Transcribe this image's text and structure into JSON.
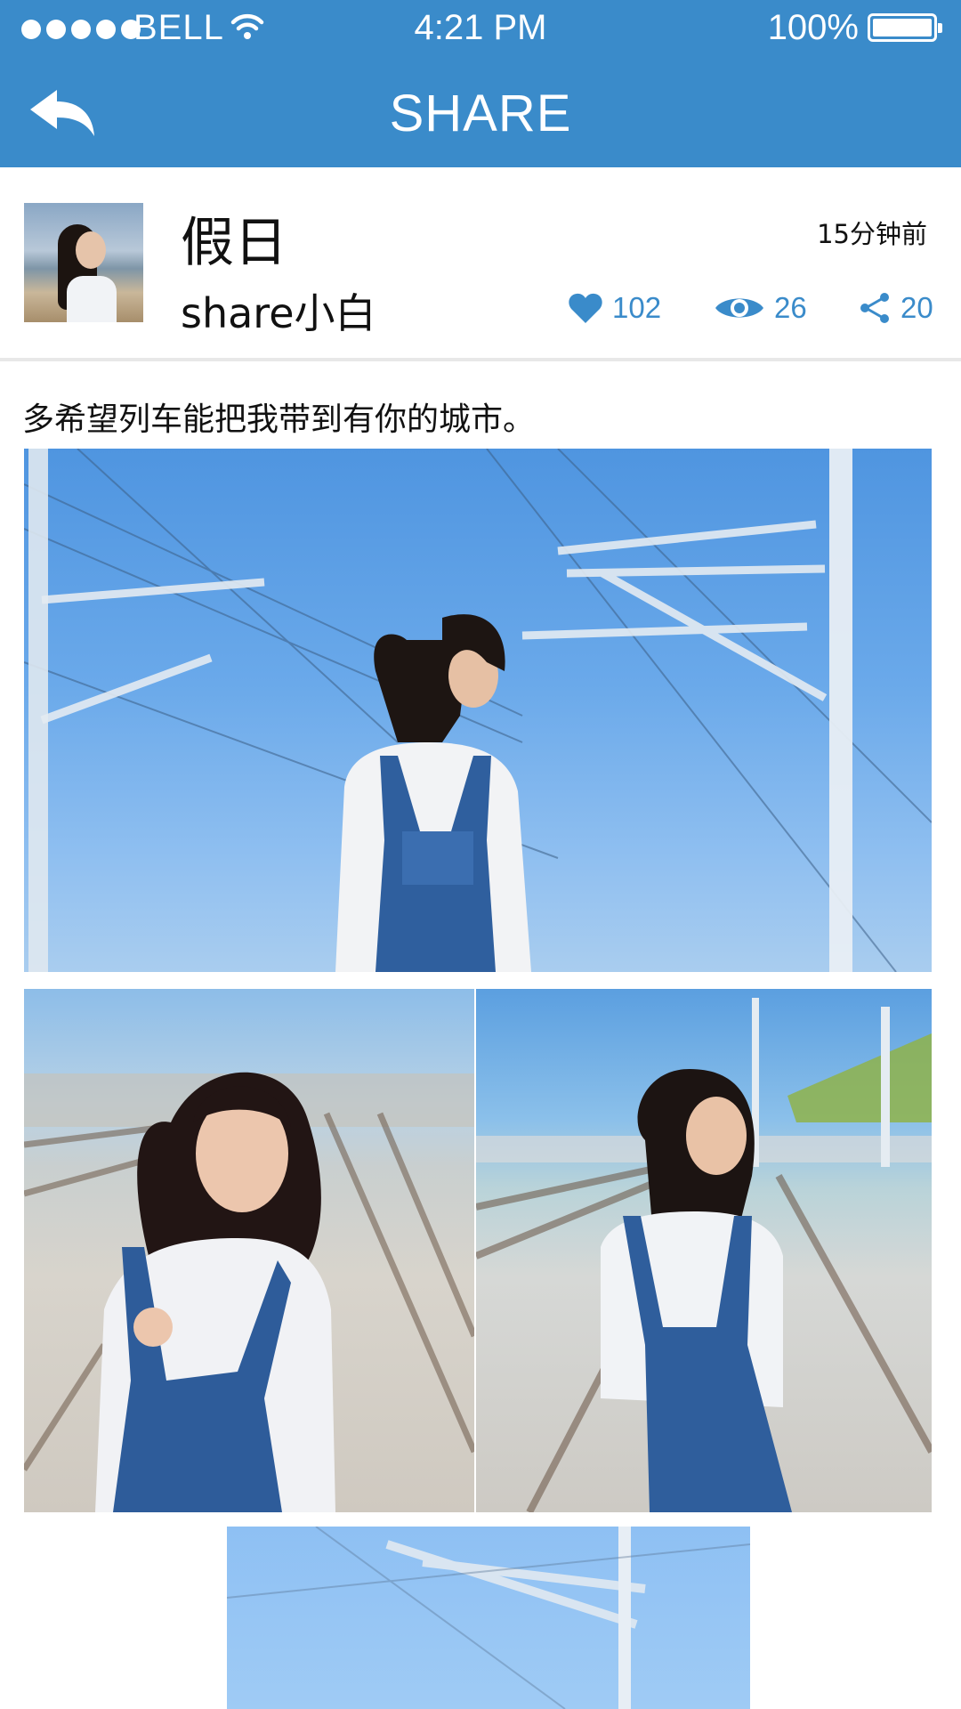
{
  "status_bar": {
    "carrier": "BELL",
    "time": "4:21 PM",
    "battery": "100%",
    "battery_level": 1.0,
    "signal_dots": 5
  },
  "navbar": {
    "back_icon": "reply-arrow-icon",
    "title": "SHARE"
  },
  "post": {
    "title": "假日",
    "username": "share小白",
    "time_ago": "15分钟前",
    "likes": "102",
    "views": "26",
    "shares": "20",
    "caption": "多希望列车能把我带到有你的城市。"
  },
  "colors": {
    "accent": "#3a8bca",
    "divider": "#e8e8e8"
  }
}
